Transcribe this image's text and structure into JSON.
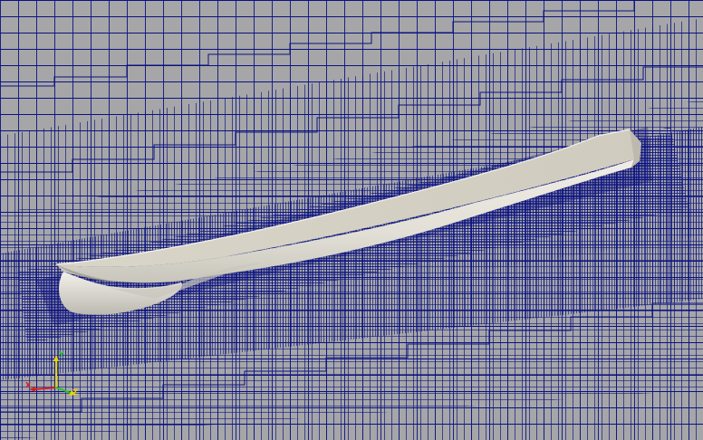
{
  "view": {
    "background_color": "#a6a6a8",
    "mesh_line_color": "#0b1280",
    "hull_color": "#e4e1d8",
    "hull_shadow_color": "#c9c6bc",
    "hull_dark_color": "#8f8d86"
  },
  "orientation_axes": {
    "x_label": "X",
    "y_label": "Y",
    "z_label": "Z",
    "x_color": "#d42020",
    "y_color": "#e4d600",
    "z_color": "#21c621"
  }
}
